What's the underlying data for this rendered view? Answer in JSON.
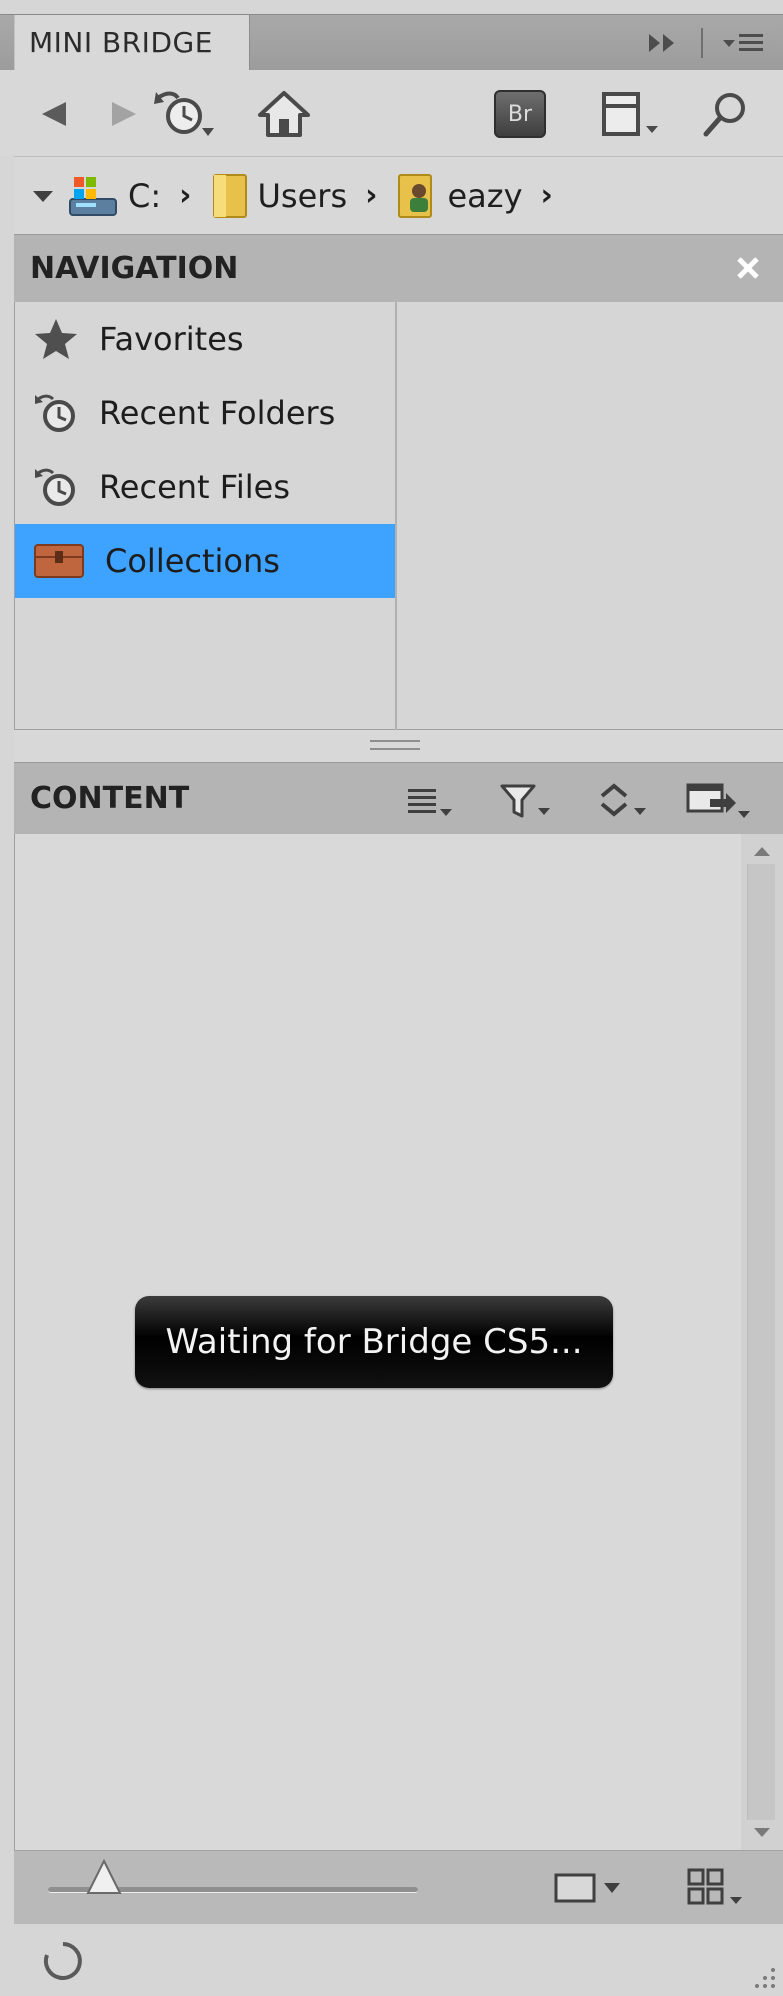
{
  "panel": {
    "tab_title": "MINI BRIDGE"
  },
  "toolbar": {
    "back_icon": "arrow-left-icon",
    "forward_icon": "arrow-right-icon",
    "recent_icon": "clock-history-icon",
    "home_icon": "home-icon",
    "bridge_label": "Br",
    "panel_view_icon": "panel-layout-icon",
    "search_icon": "magnifier-icon"
  },
  "path": {
    "items": [
      {
        "label": "C:"
      },
      {
        "label": "Users"
      },
      {
        "label": "eazy"
      }
    ]
  },
  "navigation": {
    "title": "NAVIGATION",
    "items": [
      {
        "label": "Favorites",
        "icon": "star-icon",
        "selected": false
      },
      {
        "label": "Recent Folders",
        "icon": "clock-folder-icon",
        "selected": false
      },
      {
        "label": "Recent Files",
        "icon": "clock-file-icon",
        "selected": false
      },
      {
        "label": "Collections",
        "icon": "collection-box-icon",
        "selected": true
      }
    ]
  },
  "content": {
    "title": "CONTENT",
    "status_message": "Waiting for Bridge CS5..."
  },
  "colors": {
    "selected": "#3ea2ff",
    "panel_bg": "#d6d6d6",
    "header_bg": "#b4b4b4"
  }
}
